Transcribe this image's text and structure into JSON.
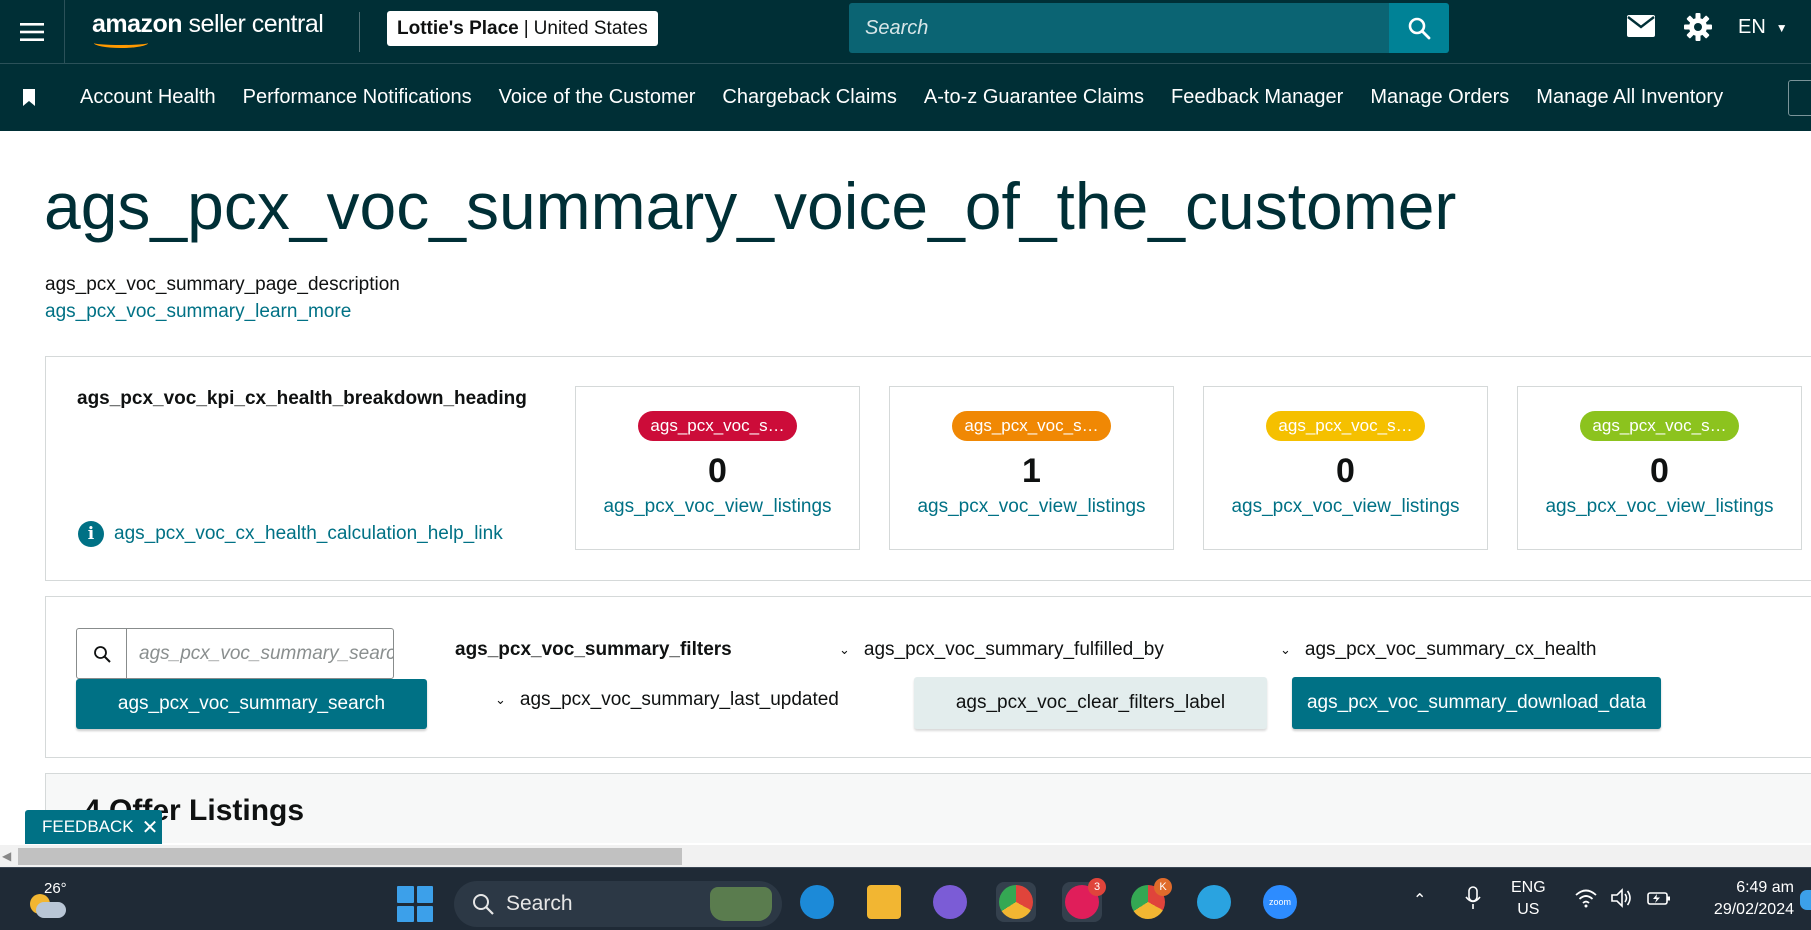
{
  "header": {
    "logo_brand": "amazon",
    "logo_product": "seller central",
    "store_name": "Lottie's Place",
    "store_region": "United States",
    "search_placeholder": "Search",
    "language": "EN",
    "icons": [
      "hamburger-menu-icon",
      "search-icon",
      "mail-icon",
      "gear-icon",
      "chevron-down-icon"
    ]
  },
  "nav": {
    "items": [
      {
        "label": "Account Health"
      },
      {
        "label": "Performance Notifications"
      },
      {
        "label": "Voice of the Customer"
      },
      {
        "label": "Chargeback Claims"
      },
      {
        "label": "A-to-z Guarantee Claims"
      },
      {
        "label": "Feedback Manager"
      },
      {
        "label": "Manage Orders"
      },
      {
        "label": "Manage All Inventory"
      }
    ]
  },
  "main": {
    "title": "ags_pcx_voc_summary_voice_of_the_customer",
    "description": "ags_pcx_voc_summary_page_description",
    "learn_more": "ags_pcx_voc_summary_learn_more",
    "kpi": {
      "heading": "ags_pcx_voc_kpi_cx_health_breakdown_heading",
      "help_link": "ags_pcx_voc_cx_health_calculation_help_link",
      "cards": [
        {
          "badge": "ags_pcx_voc_s…",
          "count": "0",
          "link": "ags_pcx_voc_view_listings",
          "color": "#cc0c39"
        },
        {
          "badge": "ags_pcx_voc_s…",
          "count": "1",
          "link": "ags_pcx_voc_view_listings",
          "color": "#f08804"
        },
        {
          "badge": "ags_pcx_voc_s…",
          "count": "0",
          "link": "ags_pcx_voc_view_listings",
          "color": "#f5c000"
        },
        {
          "badge": "ags_pcx_voc_s…",
          "count": "0",
          "link": "ags_pcx_voc_view_listings",
          "color": "#8cc31e"
        }
      ]
    },
    "filters": {
      "search_placeholder": "ags_pcx_voc_summary_search",
      "search_button": "ags_pcx_voc_summary_search",
      "label": "ags_pcx_voc_summary_filters",
      "fulfilled_by": "ags_pcx_voc_summary_fulfilled_by",
      "cx_health": "ags_pcx_voc_summary_cx_health",
      "last_updated": "ags_pcx_voc_summary_last_updated",
      "clear_filters": "ags_pcx_voc_clear_filters_label",
      "download_data": "ags_pcx_voc_summary_download_data"
    },
    "listings_title": "4 Offer Listings",
    "feedback_tab": "FEEDBACK"
  },
  "taskbar": {
    "weather_temp": "26°",
    "search_label": "Search",
    "apps": [
      {
        "name": "edge",
        "color": "#1c8ad8"
      },
      {
        "name": "file-explorer",
        "color": "#f2b632"
      },
      {
        "name": "brave",
        "color": "#7b5cd6"
      },
      {
        "name": "chrome",
        "color": "#e0443b"
      },
      {
        "name": "slack",
        "color": "#e01e5a",
        "badge": "3"
      },
      {
        "name": "chrome-profile",
        "color": "#34a853",
        "badge": "K"
      },
      {
        "name": "telegram",
        "color": "#2aa3e0"
      },
      {
        "name": "zoom",
        "color": "#2d8cff",
        "label": "zoom"
      }
    ],
    "lang_line1": "ENG",
    "lang_line2": "US",
    "time": "6:49 am",
    "date": "29/02/2024"
  }
}
